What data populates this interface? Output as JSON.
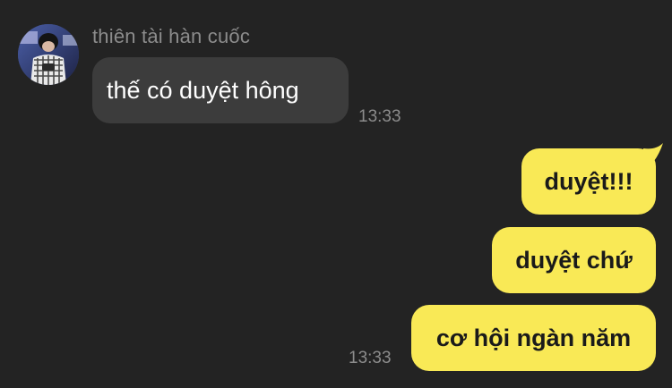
{
  "thread": {
    "sender_name": "thiên tài hàn cuốc",
    "incoming": {
      "text": "thế có duyệt hông",
      "time": "13:33"
    },
    "outgoing": [
      {
        "text": "duyệt!!!"
      },
      {
        "text": "duyệt chứ"
      },
      {
        "text": "cơ hội ngàn năm"
      }
    ],
    "outgoing_time": "13:33"
  },
  "colors": {
    "background": "#232323",
    "incoming_bubble": "#3c3c3c",
    "outgoing_bubble": "#f9e956",
    "meta_text": "#8c8c8c"
  },
  "icons": {
    "avatar": "user-avatar-photo"
  }
}
